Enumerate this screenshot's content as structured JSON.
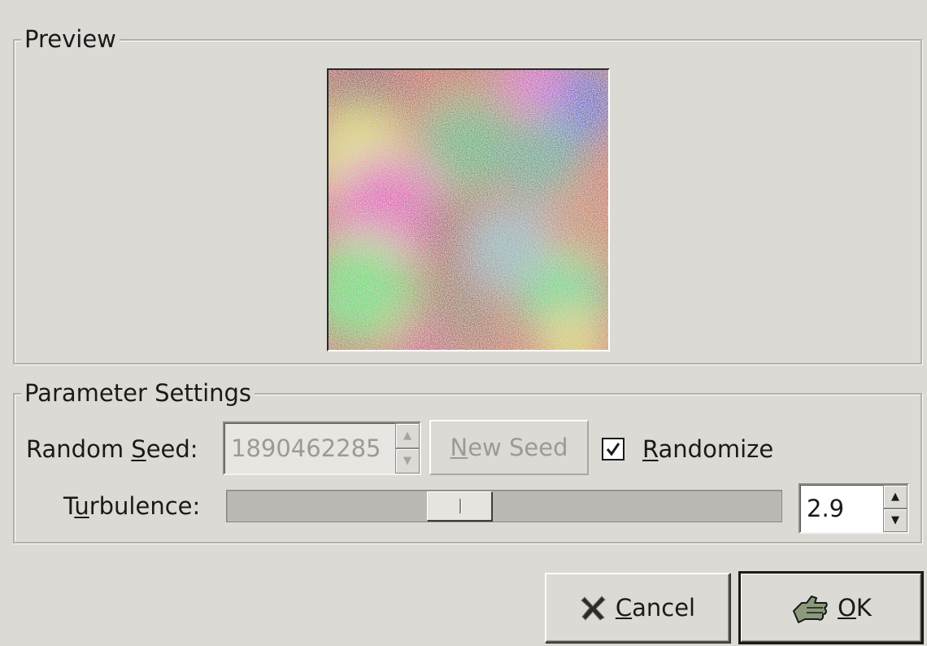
{
  "preview": {
    "legend": "Preview"
  },
  "parameters": {
    "legend": "Parameter Settings",
    "random_seed": {
      "label_pre": "Random ",
      "label_mnemonic": "S",
      "label_post": "eed:",
      "value": "1890462285"
    },
    "new_seed_button": {
      "mnemonic": "N",
      "label_post": "ew Seed"
    },
    "randomize": {
      "mnemonic": "R",
      "label_post": "andomize",
      "checked": true
    },
    "turbulence": {
      "label_pre": "T",
      "label_mnemonic": "u",
      "label_post": "rbulence:",
      "value": "2.9",
      "slider_fraction": 0.42
    }
  },
  "actions": {
    "cancel": {
      "mnemonic": "C",
      "label_post": "ancel",
      "icon": "x-cancel-icon"
    },
    "ok": {
      "mnemonic": "O",
      "label_post": "K",
      "icon": "hand-ok-icon"
    }
  }
}
